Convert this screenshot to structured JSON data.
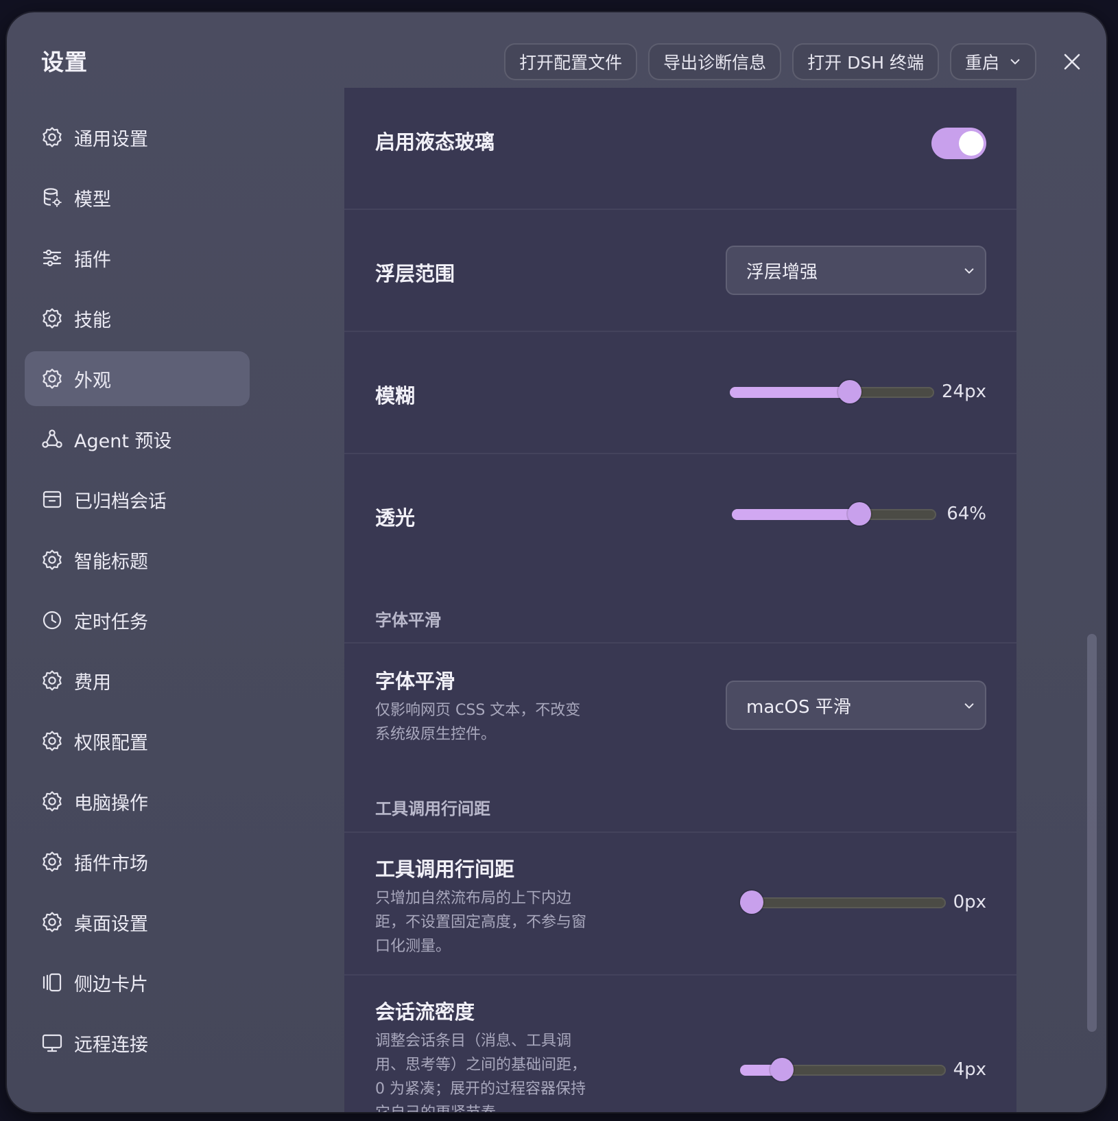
{
  "window": {
    "title": "设置"
  },
  "toolbar": {
    "open_config": "打开配置文件",
    "export_diag": "导出诊断信息",
    "open_dsh": "打开 DSH 终端",
    "restart": "重启"
  },
  "sidebar": {
    "items": [
      {
        "label": "通用设置",
        "icon": "gear-icon"
      },
      {
        "label": "模型",
        "icon": "database-gear-icon"
      },
      {
        "label": "插件",
        "icon": "sliders-icon"
      },
      {
        "label": "技能",
        "icon": "gear-icon"
      },
      {
        "label": "外观",
        "icon": "gear-icon",
        "active": true
      },
      {
        "label": "Agent 预设",
        "icon": "agent-nodes-icon"
      },
      {
        "label": "已归档会话",
        "icon": "archive-icon"
      },
      {
        "label": "智能标题",
        "icon": "gear-icon"
      },
      {
        "label": "定时任务",
        "icon": "clock-icon"
      },
      {
        "label": "费用",
        "icon": "gear-icon"
      },
      {
        "label": "权限配置",
        "icon": "gear-icon"
      },
      {
        "label": "电脑操作",
        "icon": "gear-icon"
      },
      {
        "label": "插件市场",
        "icon": "gear-icon"
      },
      {
        "label": "桌面设置",
        "icon": "gear-icon"
      },
      {
        "label": "侧边卡片",
        "icon": "side-cards-icon"
      },
      {
        "label": "远程连接",
        "icon": "monitor-icon"
      }
    ]
  },
  "settings": {
    "liquid_glass": {
      "label": "启用液态玻璃",
      "enabled": true
    },
    "overlay_scope": {
      "label": "浮层范围",
      "value": "浮层增强"
    },
    "blur": {
      "label": "模糊",
      "value": 24,
      "min": 0,
      "max": 40,
      "value_text": "24px"
    },
    "translucency": {
      "label": "透光",
      "value": 64,
      "min": 0,
      "max": 100,
      "value_text": "64%"
    },
    "font_section": "字体平滑",
    "font_smoothing": {
      "label": "字体平滑",
      "desc": "仅影响网页 CSS 文本，不改变系统级原生控件。",
      "value": "macOS 平滑"
    },
    "tool_section": "工具调用行间距",
    "tool_spacing": {
      "label": "工具调用行间距",
      "desc": "只增加自然流布局的上下内边距，不设置固定高度，不参与窗口化测量。",
      "value": 0,
      "min": 0,
      "max": 20,
      "value_text": "0px"
    },
    "density": {
      "label": "会话流密度",
      "desc": "调整会话条目（消息、工具调用、思考等）之间的基础间距，0 为紧凑；展开的过程容器保持它自己的更紧节奏。",
      "value": 4,
      "min": 0,
      "max": 24,
      "value_text": "4px"
    }
  },
  "colors": {
    "accent": "#c8a0ec",
    "panel": "#393852",
    "window": "#4a4b5f"
  }
}
